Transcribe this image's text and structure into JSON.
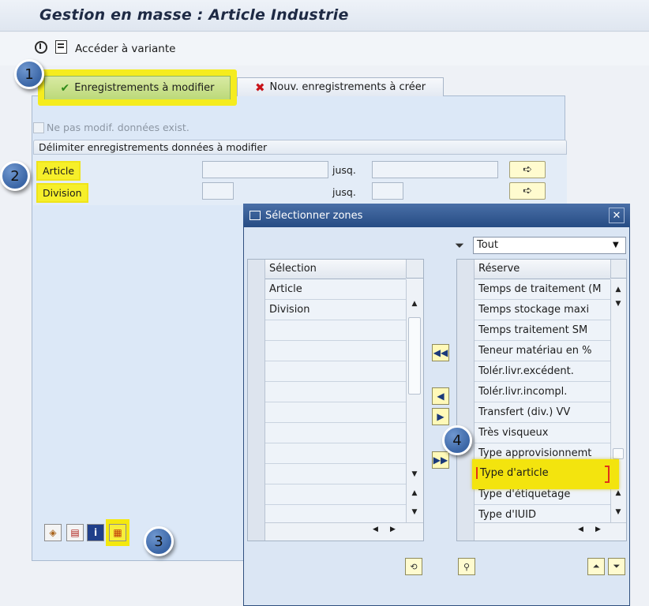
{
  "window": {
    "title": "Gestion en masse : Article Industrie"
  },
  "toolbar": {
    "variant_label": "Accéder à variante"
  },
  "tabs": [
    {
      "label": "Enregistrements à modifier",
      "active": true
    },
    {
      "label": "Nouv. enregistrements à créer",
      "active": false
    }
  ],
  "options": {
    "no_modify_label": "Ne pas modif. données exist."
  },
  "section": {
    "title": "Délimiter enregistrements données à modifier",
    "rows": [
      {
        "label": "Article",
        "from": "",
        "to_label": "jusq.",
        "to": ""
      },
      {
        "label": "Division",
        "from": "",
        "to_label": "jusq.",
        "to": ""
      }
    ]
  },
  "markers": [
    "1",
    "2",
    "3",
    "4"
  ],
  "dialog": {
    "title": "Sélectionner zones",
    "filter_value": "Tout",
    "selection": {
      "header": "Sélection",
      "items": [
        "Article",
        "Division"
      ]
    },
    "reserve": {
      "header": "Réserve",
      "items": [
        "Temps de traitement (M",
        "Temps stockage maxi",
        "Temps traitement SM",
        "Teneur matériau en %",
        "Tolér.livr.excédent.",
        "Tolér.livr.incompl.",
        "Transfert (div.) VV",
        "Très visqueux",
        "Type approvisionnemt",
        "Type d'article",
        "Type d'étiquetage",
        "Type d'IUID"
      ],
      "highlighted": "Type d'article"
    }
  },
  "colors": {
    "highlight": "#f5ec1e",
    "dialog_title_bar": "#264c84",
    "marker": "#3b66a6",
    "panel": "#dce8f7"
  }
}
